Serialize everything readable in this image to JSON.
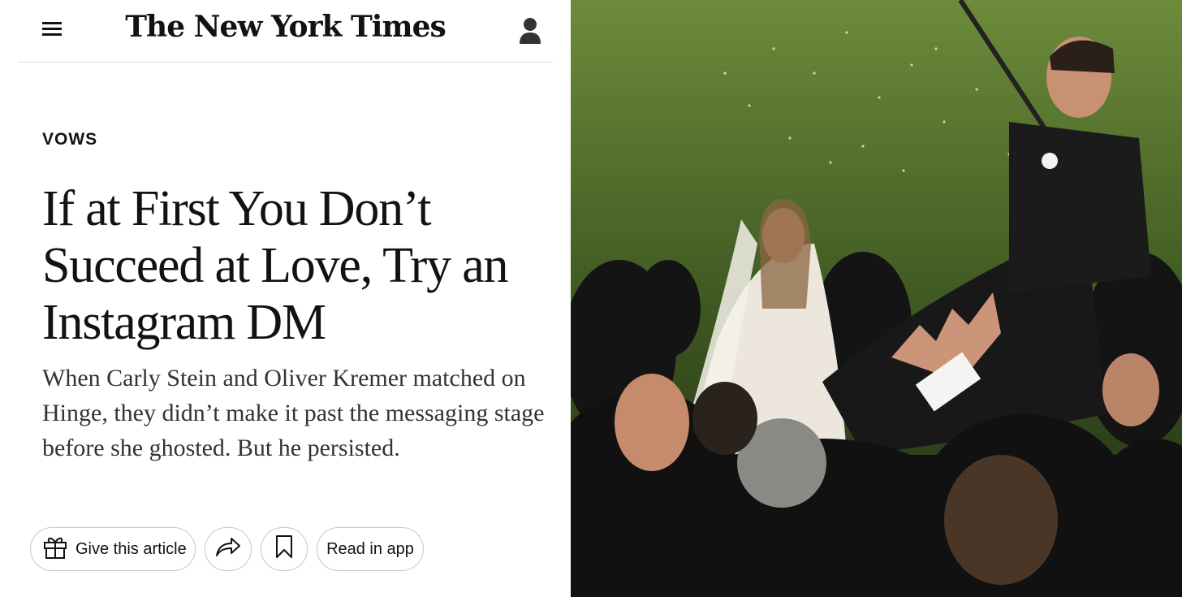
{
  "header": {
    "masthead": "The New York Times"
  },
  "article": {
    "kicker": "VOWS",
    "headline_lines": [
      "If at First You Don’t",
      "Succeed at Love, Try an",
      "Instagram DM"
    ],
    "summary": "When Carly Stein and Oliver Kremer matched on Hinge, they didn’t make it past the messaging stage before she ghosted. But he persisted."
  },
  "actions": {
    "gift_label": "Give this article",
    "read_in_app_label": "Read in app"
  },
  "icons": {
    "menu": "hamburger-menu-icon",
    "account": "person-icon",
    "gift": "gift-icon",
    "share": "share-arrow-icon",
    "save": "bookmark-icon"
  },
  "colors": {
    "text": "#121212",
    "border": "#c7c7c7"
  }
}
